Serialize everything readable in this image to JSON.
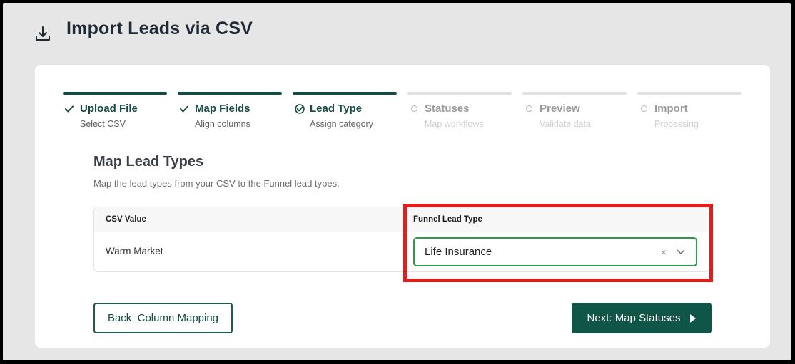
{
  "header": {
    "icon": "download-icon",
    "title": "Import Leads via CSV"
  },
  "steps": [
    {
      "label": "Upload File",
      "sub": "Select CSV",
      "state": "done"
    },
    {
      "label": "Map Fields",
      "sub": "Align columns",
      "state": "done"
    },
    {
      "label": "Lead Type",
      "sub": "Assign category",
      "state": "active"
    },
    {
      "label": "Statuses",
      "sub": "Map workflows",
      "state": "pending"
    },
    {
      "label": "Preview",
      "sub": "Validate data",
      "state": "pending"
    },
    {
      "label": "Import",
      "sub": "Processing",
      "state": "pending"
    }
  ],
  "main": {
    "title": "Map Lead Types",
    "description": "Map the lead types from your CSV to the Funnel lead types."
  },
  "table": {
    "columns": [
      "CSV Value",
      "Funnel Lead Type"
    ],
    "rows": [
      {
        "csv_value": "Warm Market",
        "funnel_lead_type": "Life Insurance"
      }
    ],
    "select_clear": "×"
  },
  "buttons": {
    "back": "Back: Column Mapping",
    "next": "Next: Map Statuses"
  },
  "colors": {
    "primary": "#0f5548",
    "select_border": "#2e9b4a",
    "highlight": "#e01e1e"
  }
}
